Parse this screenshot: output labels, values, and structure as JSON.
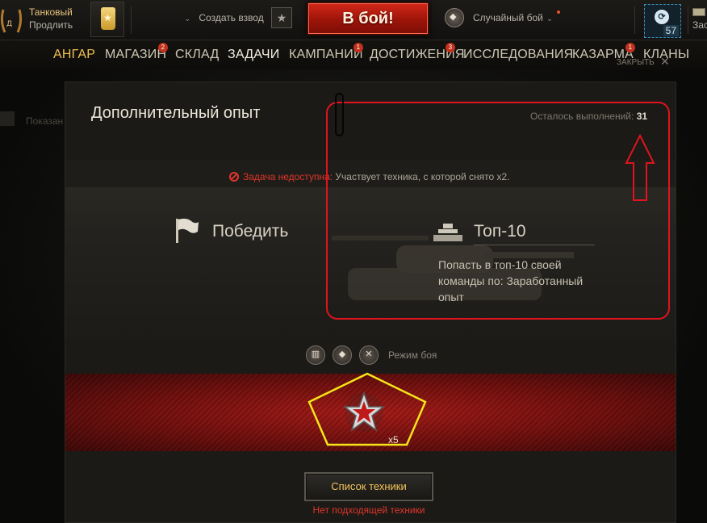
{
  "account": {
    "type_label": "Танковый",
    "extend_label": "Продлить"
  },
  "topbar": {
    "create_platoon": "Создать взвод",
    "battle_button": "В бой!",
    "battle_mode": "Случайный бой",
    "xp_count": "57",
    "right_cut_label": "Зас"
  },
  "nav": {
    "items": [
      {
        "label": "АНГАР"
      },
      {
        "label": "МАГАЗИН",
        "badge": "2"
      },
      {
        "label": "СКЛАД"
      },
      {
        "label": "ЗАДАЧИ"
      },
      {
        "label": "КАМПАНИИ",
        "badge": "1"
      },
      {
        "label": "ДОСТИЖЕНИЯ",
        "badge": "3"
      },
      {
        "label": "ИССЛЕДОВАНИЯ"
      },
      {
        "label": "КАЗАРМА",
        "badge": "1"
      },
      {
        "label": "КЛАНЫ"
      }
    ],
    "close_label": "ЗАКРЫТЬ"
  },
  "background": {
    "ghost_text": "Показан"
  },
  "dialog": {
    "title": "Дополнительный опыт",
    "remaining_label": "Осталось выполнений:",
    "remaining_value": "31",
    "warning_red": "Задача недоступна:",
    "warning_text": "Участвует техника, с которой снято x2.",
    "condition_left": "Победить",
    "condition_right": "Топ-10",
    "condition_desc": "Попасть в топ-10 своей команды по: Заработанный опыт",
    "mode_label": "Режим боя",
    "reward_count": "x5",
    "vehicle_list_button": "Список техники",
    "no_vehicles": "Нет подходящей техники"
  },
  "colors": {
    "accent_gold": "#f0c054",
    "warning_red": "#e0352a",
    "annotation_red": "#e0131e",
    "annotation_yellow": "#f5e51a"
  }
}
